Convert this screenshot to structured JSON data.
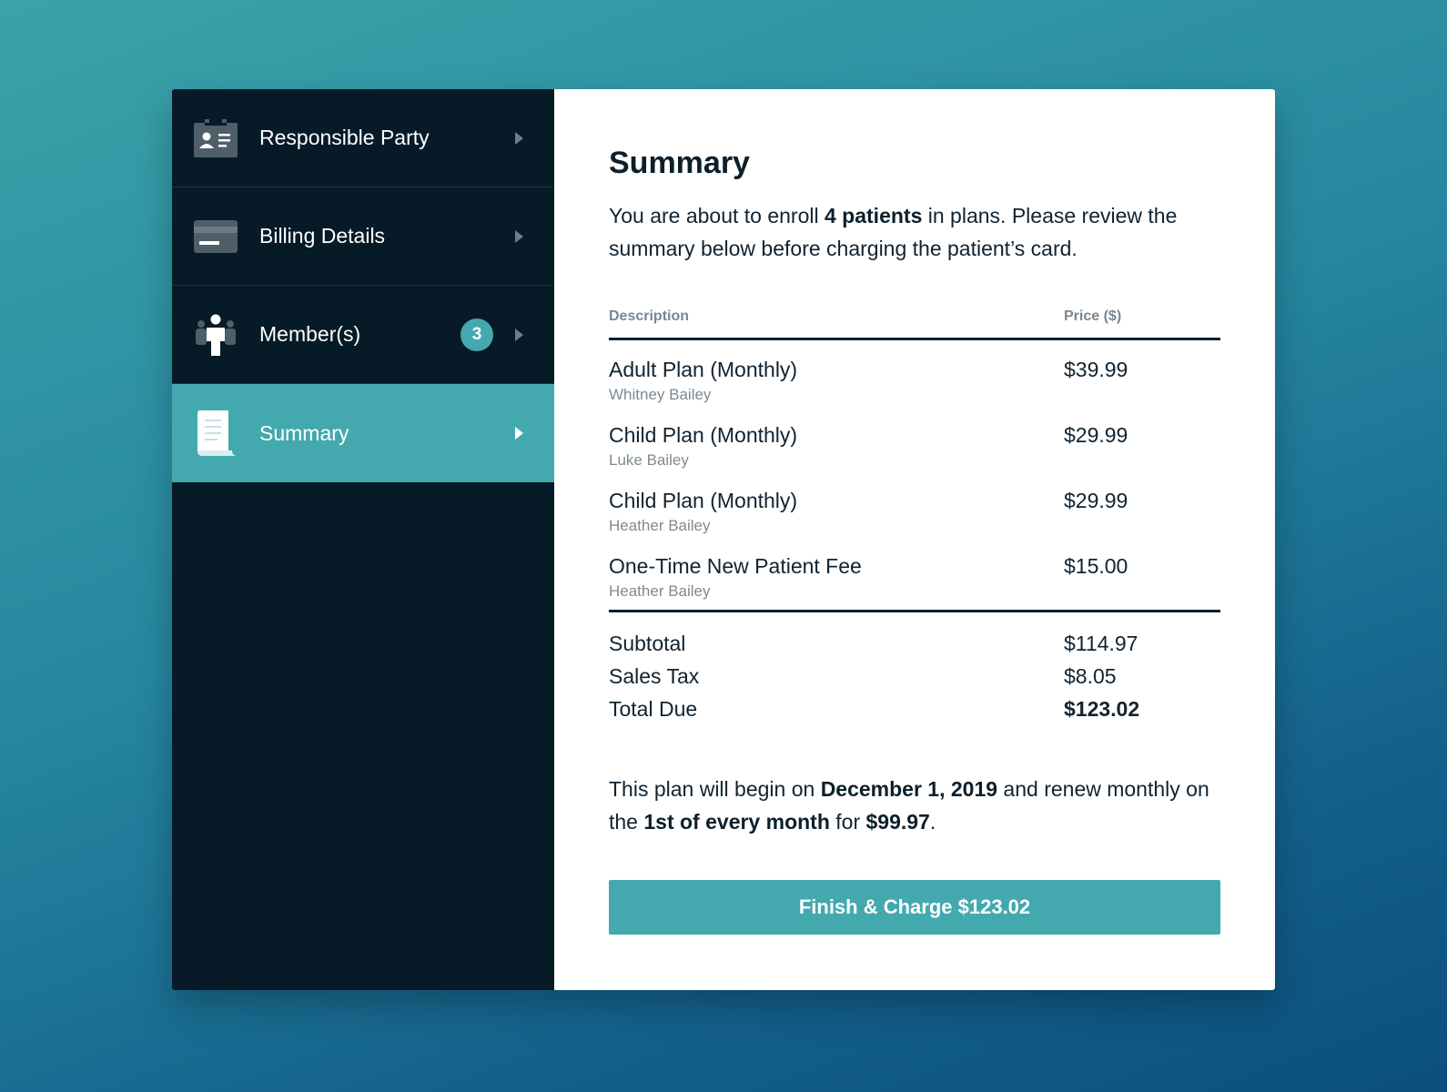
{
  "sidebar": {
    "items": [
      {
        "label": "Responsible Party",
        "icon": "id-card-icon"
      },
      {
        "label": "Billing Details",
        "icon": "credit-card-icon"
      },
      {
        "label": "Member(s)",
        "icon": "people-icon",
        "badge": "3"
      },
      {
        "label": "Summary",
        "icon": "receipt-icon",
        "active": true
      }
    ]
  },
  "main": {
    "title": "Summary",
    "intro": {
      "before": "You are about to enroll ",
      "strong": "4 patients",
      "after": " in plans. Please review the summary below before charging the patient’s card."
    },
    "table": {
      "headers": {
        "description": "Description",
        "price": "Price ($)"
      },
      "rows": [
        {
          "name": "Adult Plan (Monthly)",
          "person": "Whitney Bailey",
          "price": "$39.99"
        },
        {
          "name": "Child Plan (Monthly)",
          "person": "Luke Bailey",
          "price": "$29.99"
        },
        {
          "name": "Child Plan (Monthly)",
          "person": "Heather Bailey",
          "price": "$29.99"
        },
        {
          "name": "One-Time New Patient Fee",
          "person": "Heather Bailey",
          "price": "$15.00"
        }
      ],
      "totals": [
        {
          "label": "Subtotal",
          "value": "$114.97"
        },
        {
          "label": "Sales Tax",
          "value": "$8.05"
        },
        {
          "label": "Total Due",
          "value": "$123.02"
        }
      ]
    },
    "footnote": {
      "part1": "This plan will begin on ",
      "date": "December 1, 2019",
      "part2": " and renew monthly on the ",
      "cycle": "1st of every month",
      "part3": " for ",
      "amount": "$99.97",
      "part4": "."
    },
    "cta_label": "Finish & Charge $123.02"
  },
  "colors": {
    "accent": "#43a9ae",
    "sidebar_bg": "#061b27",
    "text_dark": "#0c1f2b"
  }
}
